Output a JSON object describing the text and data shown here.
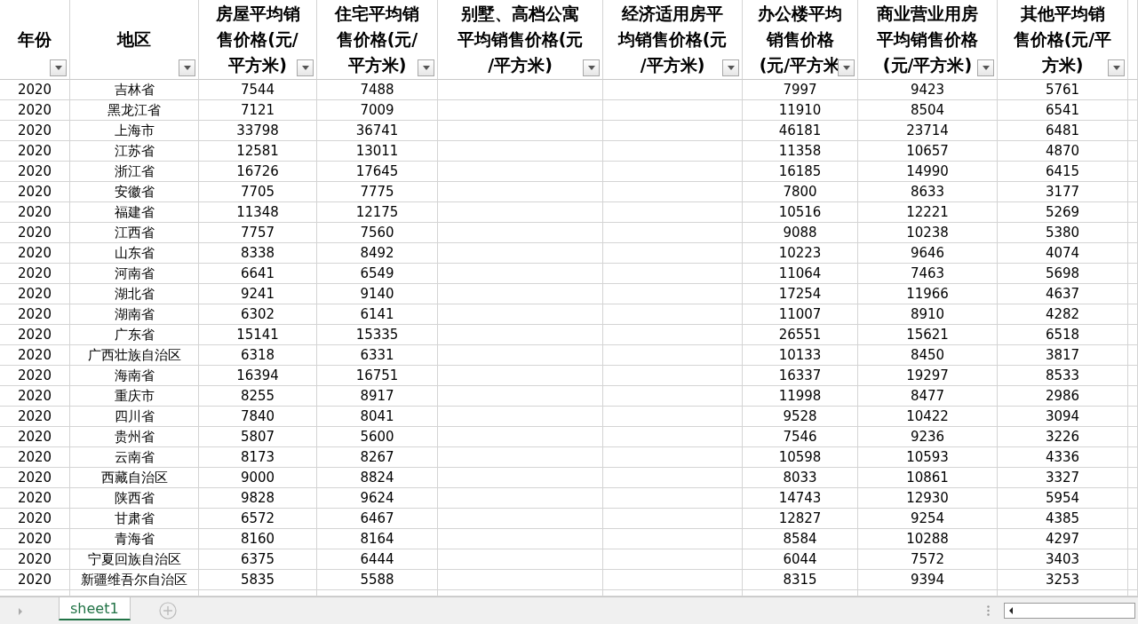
{
  "columns": [
    {
      "lines": [
        "年份"
      ]
    },
    {
      "lines": [
        "地区"
      ]
    },
    {
      "lines": [
        "房屋平均销",
        "售价格(元/",
        "平方米)"
      ]
    },
    {
      "lines": [
        "住宅平均销",
        "售价格(元/",
        "平方米)"
      ]
    },
    {
      "lines": [
        "别墅、高档公寓",
        "平均销售价格(元",
        "/平方米)"
      ]
    },
    {
      "lines": [
        "经济适用房平",
        "均销售价格(元",
        "/平方米)"
      ]
    },
    {
      "lines": [
        "办公楼平均",
        "销售价格",
        "(元/平方米"
      ]
    },
    {
      "lines": [
        "商业营业用房",
        "平均销售价格",
        "(元/平方米)"
      ]
    },
    {
      "lines": [
        "其他平均销",
        "售价格(元/平",
        "方米)"
      ]
    }
  ],
  "rows": [
    [
      "2020",
      "吉林省",
      "7544",
      "7488",
      null,
      null,
      "7997",
      "9423",
      "5761"
    ],
    [
      "2020",
      "黑龙江省",
      "7121",
      "7009",
      null,
      null,
      "11910",
      "8504",
      "6541"
    ],
    [
      "2020",
      "上海市",
      "33798",
      "36741",
      null,
      null,
      "46181",
      "23714",
      "6481"
    ],
    [
      "2020",
      "江苏省",
      "12581",
      "13011",
      null,
      null,
      "11358",
      "10657",
      "4870"
    ],
    [
      "2020",
      "浙江省",
      "16726",
      "17645",
      null,
      null,
      "16185",
      "14990",
      "6415"
    ],
    [
      "2020",
      "安徽省",
      "7705",
      "7775",
      null,
      null,
      "7800",
      "8633",
      "3177"
    ],
    [
      "2020",
      "福建省",
      "11348",
      "12175",
      null,
      null,
      "10516",
      "12221",
      "5269"
    ],
    [
      "2020",
      "江西省",
      "7757",
      "7560",
      null,
      null,
      "9088",
      "10238",
      "5380"
    ],
    [
      "2020",
      "山东省",
      "8338",
      "8492",
      null,
      null,
      "10223",
      "9646",
      "4074"
    ],
    [
      "2020",
      "河南省",
      "6641",
      "6549",
      null,
      null,
      "11064",
      "7463",
      "5698"
    ],
    [
      "2020",
      "湖北省",
      "9241",
      "9140",
      null,
      null,
      "17254",
      "11966",
      "4637"
    ],
    [
      "2020",
      "湖南省",
      "6302",
      "6141",
      null,
      null,
      "11007",
      "8910",
      "4282"
    ],
    [
      "2020",
      "广东省",
      "15141",
      "15335",
      null,
      null,
      "26551",
      "15621",
      "6518"
    ],
    [
      "2020",
      "广西壮族自治区",
      "6318",
      "6331",
      null,
      null,
      "10133",
      "8450",
      "3817"
    ],
    [
      "2020",
      "海南省",
      "16394",
      "16751",
      null,
      null,
      "16337",
      "19297",
      "8533"
    ],
    [
      "2020",
      "重庆市",
      "8255",
      "8917",
      null,
      null,
      "11998",
      "8477",
      "2986"
    ],
    [
      "2020",
      "四川省",
      "7840",
      "8041",
      null,
      null,
      "9528",
      "10422",
      "3094"
    ],
    [
      "2020",
      "贵州省",
      "5807",
      "5600",
      null,
      null,
      "7546",
      "9236",
      "3226"
    ],
    [
      "2020",
      "云南省",
      "8173",
      "8267",
      null,
      null,
      "10598",
      "10593",
      "4336"
    ],
    [
      "2020",
      "西藏自治区",
      "9000",
      "8824",
      null,
      null,
      "8033",
      "10861",
      "3327"
    ],
    [
      "2020",
      "陕西省",
      "9828",
      "9624",
      null,
      null,
      "14743",
      "12930",
      "5954"
    ],
    [
      "2020",
      "甘肃省",
      "6572",
      "6467",
      null,
      null,
      "12827",
      "9254",
      "4385"
    ],
    [
      "2020",
      "青海省",
      "8160",
      "8164",
      null,
      null,
      "8584",
      "10288",
      "4297"
    ],
    [
      "2020",
      "宁夏回族自治区",
      "6375",
      "6444",
      null,
      null,
      "6044",
      "7572",
      "3403"
    ],
    [
      "2020",
      "新疆维吾尔自治区",
      "5835",
      "5588",
      null,
      null,
      "8315",
      "9394",
      "3253"
    ]
  ],
  "sheet_tabs": [
    {
      "label": "sheet1",
      "selected": true
    }
  ]
}
